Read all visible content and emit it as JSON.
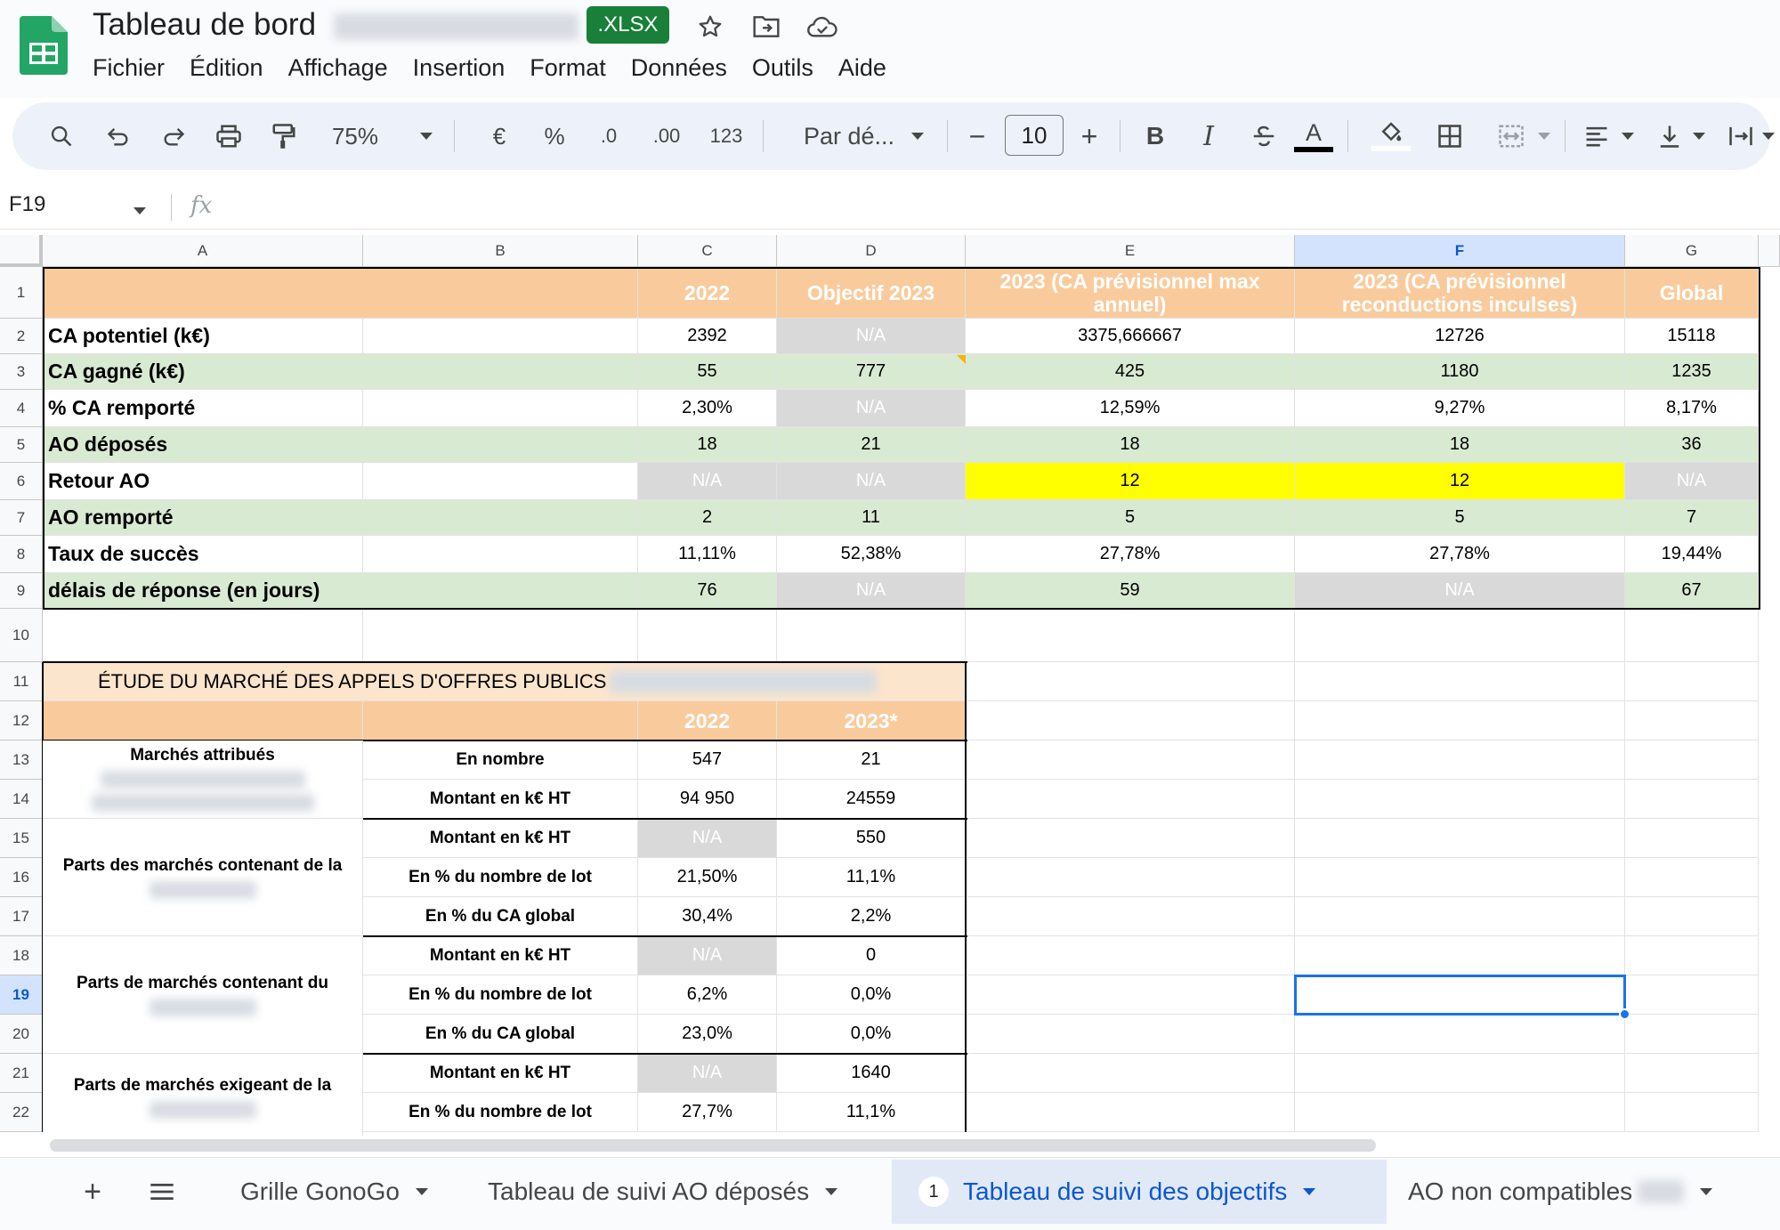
{
  "titlebar": {
    "doc_title": "Tableau de bord",
    "format_badge": ".XLSX",
    "icons": [
      "star-icon",
      "move-to-folder-icon",
      "cloud-saved-icon"
    ]
  },
  "menu": [
    "Fichier",
    "Édition",
    "Affichage",
    "Insertion",
    "Format",
    "Données",
    "Outils",
    "Aide"
  ],
  "toolbar": {
    "zoom": "75%",
    "currency": "€",
    "percent": "%",
    "decrease_decimals": ".0",
    "increase_decimals": ".00",
    "number_format": "123",
    "font": "Par dé...",
    "minus": "−",
    "font_size": "10",
    "plus": "+",
    "bold": "B",
    "italic": "I",
    "text_color_letter": "A"
  },
  "formula_bar": {
    "cell_ref": "F19",
    "fx": "fx",
    "value": ""
  },
  "columns": [
    "A",
    "B",
    "C",
    "D",
    "E",
    "F",
    "G"
  ],
  "rows": [
    "1",
    "2",
    "3",
    "4",
    "5",
    "6",
    "7",
    "8",
    "9",
    "10",
    "11",
    "12",
    "13",
    "14",
    "15",
    "16",
    "17",
    "18",
    "19",
    "20",
    "21",
    "22"
  ],
  "table1": {
    "headers": [
      "2022",
      "Objectif 2023",
      "2023 (CA prévisionnel max annuel)",
      "2023 (CA prévisionnel reconductions inculses)",
      "Global"
    ],
    "rows": [
      {
        "label": "CA potentiel (k€)",
        "values": [
          "2392",
          "N/A",
          "3375,666667",
          "12726",
          "15118"
        ]
      },
      {
        "label": "CA gagné (k€)",
        "values": [
          "55",
          "777",
          "425",
          "1180",
          "1235"
        ]
      },
      {
        "label": "% CA remporté",
        "values": [
          "2,30%",
          "N/A",
          "12,59%",
          "9,27%",
          "8,17%"
        ]
      },
      {
        "label": "AO déposés",
        "values": [
          "18",
          "21",
          "18",
          "18",
          "36"
        ]
      },
      {
        "label": "Retour AO",
        "values": [
          "N/A",
          "N/A",
          "12",
          "12",
          "N/A"
        ]
      },
      {
        "label": "AO remporté",
        "values": [
          "2",
          "11",
          "5",
          "5",
          "7"
        ]
      },
      {
        "label": "Taux de succès",
        "values": [
          "11,11%",
          "52,38%",
          "27,78%",
          "27,78%",
          "19,44%"
        ]
      },
      {
        "label": "délais de réponse (en jours)",
        "values": [
          "76",
          "N/A",
          "59",
          "N/A",
          "67"
        ]
      }
    ]
  },
  "table2": {
    "title": "ÉTUDE DU MARCHÉ DES APPELS D'OFFRES PUBLICS",
    "headers": [
      "2022",
      "2023*"
    ],
    "groups": [
      {
        "label": "Marchés attribués",
        "rows": [
          {
            "metric": "En nombre",
            "values": [
              "547",
              "21"
            ]
          },
          {
            "metric": "Montant en k€ HT",
            "values": [
              "94 950",
              "24559"
            ]
          }
        ]
      },
      {
        "label": "Parts des marchés contenant de la",
        "rows": [
          {
            "metric": "Montant en k€ HT",
            "values": [
              "N/A",
              "550"
            ]
          },
          {
            "metric": "En % du nombre de lot",
            "values": [
              "21,50%",
              "11,1%"
            ]
          },
          {
            "metric": "En % du CA global",
            "values": [
              "30,4%",
              "2,2%"
            ]
          }
        ]
      },
      {
        "label": "Parts de marchés contenant du",
        "rows": [
          {
            "metric": "Montant en k€ HT",
            "values": [
              "N/A",
              "0"
            ]
          },
          {
            "metric": "En % du nombre de lot",
            "values": [
              "6,2%",
              "0,0%"
            ]
          },
          {
            "metric": "En % du CA global",
            "values": [
              "23,0%",
              "0,0%"
            ]
          }
        ]
      },
      {
        "label": "Parts de marchés exigeant de la",
        "rows": [
          {
            "metric": "Montant en k€ HT",
            "values": [
              "N/A",
              "1640"
            ]
          },
          {
            "metric": "En % du nombre de lot",
            "values": [
              "27,7%",
              "11,1%"
            ]
          }
        ]
      }
    ]
  },
  "sheet_tabs": [
    {
      "label": "Grille GonoGo",
      "active": false
    },
    {
      "label": "Tableau de suivi AO déposés",
      "active": false
    },
    {
      "label": "Tableau de suivi des objectifs",
      "active": true,
      "badge": "1"
    },
    {
      "label": "AO non compatibles",
      "active": false
    }
  ],
  "colors": {
    "header_orange": "#f9cb9c",
    "row_green": "#d9ead3",
    "na_grey": "#d9d9d9",
    "highlight_yellow": "#ffff00",
    "selection_blue": "#1a73e8",
    "xlsx_badge": "#188038"
  }
}
